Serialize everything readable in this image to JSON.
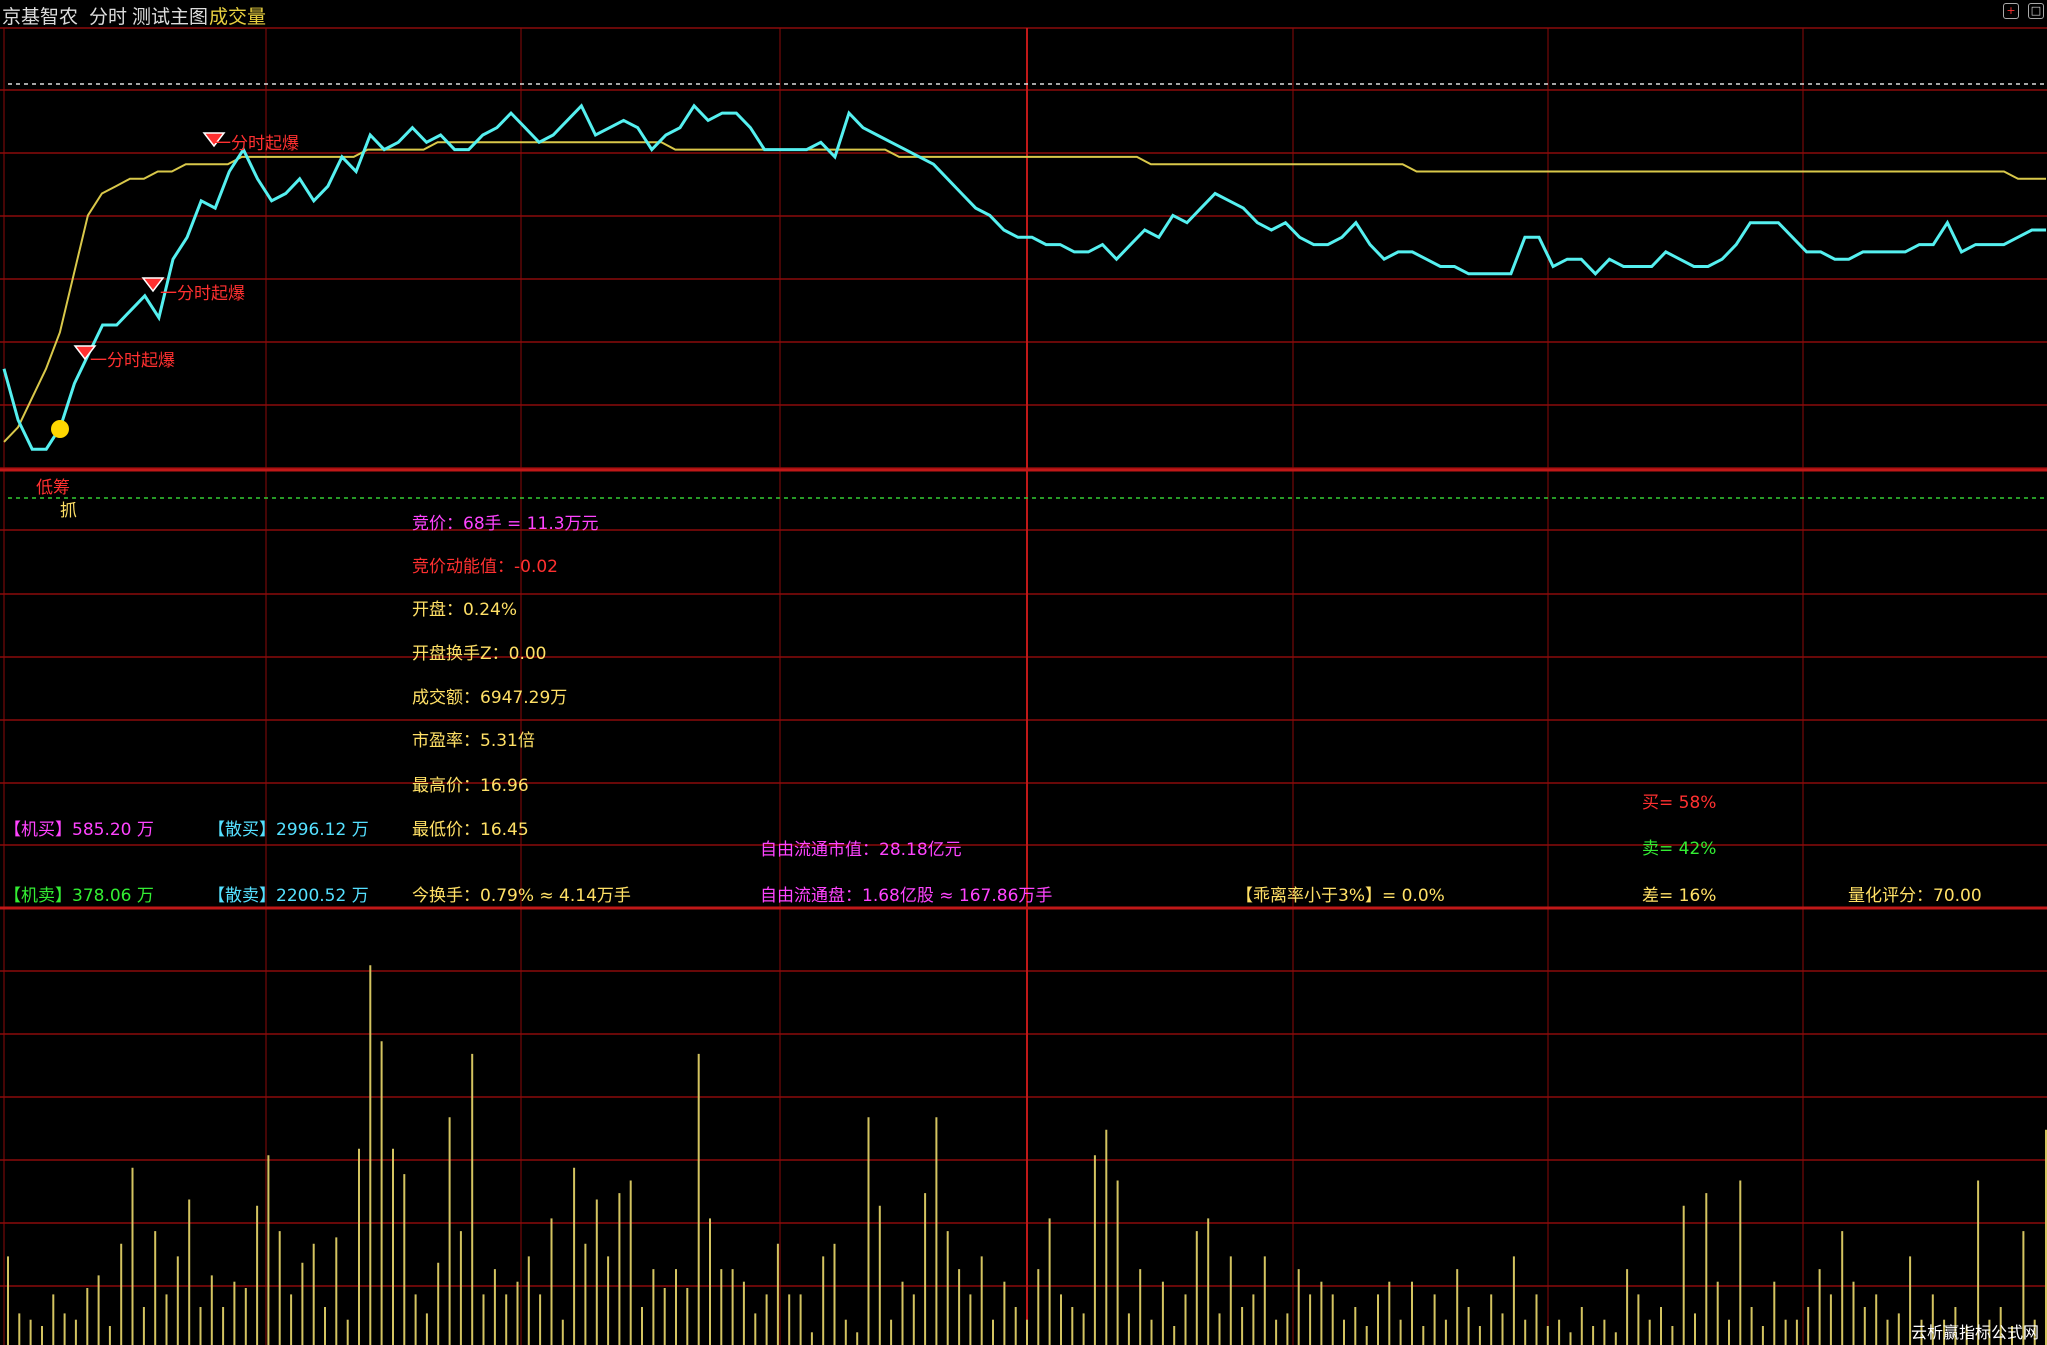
{
  "header": {
    "stock_name": "京基智农",
    "tab_intraday": "分时",
    "tab_main_chart": "测试主图",
    "tab_volume": "成交量"
  },
  "colors": {
    "background": "#000000",
    "grid": "#8b0a0a",
    "price_line": "#55f0f0",
    "avg_line": "#d9c84a",
    "volume_bar": "#d4c460",
    "magenta": "#ff44ff",
    "red": "#ff3030",
    "yellow": "#ffe066",
    "green": "#33ee33",
    "cyan": "#55e0ff"
  },
  "signals": {
    "signal_1": "一分时起爆",
    "signal_2": "一分时起爆",
    "signal_3": "一分时起爆",
    "dip_label": "低筹",
    "catch_label": "抓"
  },
  "stats": {
    "bid_price": "竞价：68手 = 11.3万元",
    "bid_momentum": "竞价动能值：-0.02",
    "open": "开盘：0.24%",
    "open_turnover": "开盘换手Z：0.00",
    "amount": "成交额：6947.29万",
    "pe": "市盈率：5.31倍",
    "high": "最高价：16.96",
    "low": "最低价：16.45",
    "turnover_today": "今换手：0.79% ≈ 4.14万手",
    "free_float_mv": "自由流通市值：28.18亿元",
    "free_float_shares": "自由流通盘：1.68亿股 ≈ 167.86万手",
    "deviation": "【乖离率小于3%】= 0.0%",
    "buy_pct": "买= 58%",
    "sell_pct": "卖= 42%",
    "diff_pct": "差= 16%",
    "quant_score": "量化评分：70.00",
    "inst_buy": "【机买】585.20 万",
    "retail_buy": "【散买】2996.12 万",
    "inst_sell": "【机卖】378.06 万",
    "retail_sell": "【散卖】2200.52 万"
  },
  "chart_data": {
    "type": "line",
    "series": [
      {
        "values": [
          16.6,
          16.53,
          16.49,
          16.49,
          16.52,
          16.58,
          16.62,
          16.66,
          16.66,
          16.68,
          16.7,
          16.67,
          16.75,
          16.78,
          16.83,
          16.82,
          16.87,
          16.9,
          16.86,
          16.83,
          16.84,
          16.86,
          16.83,
          16.85,
          16.89,
          16.87,
          16.92,
          16.9,
          16.91,
          16.93,
          16.91,
          16.92,
          16.9,
          16.9,
          16.92,
          16.93,
          16.95,
          16.93,
          16.91,
          16.92,
          16.94,
          16.96,
          16.92,
          16.93,
          16.94,
          16.93,
          16.9,
          16.92,
          16.93,
          16.96,
          16.94,
          16.95,
          16.95,
          16.93,
          16.9,
          16.9,
          16.9,
          16.9,
          16.91,
          16.89,
          16.95,
          16.93,
          16.92,
          16.91,
          16.9,
          16.89,
          16.88,
          16.86,
          16.84,
          16.82,
          16.81,
          16.79,
          16.78,
          16.78,
          16.77,
          16.77,
          16.76,
          16.76,
          16.77,
          16.75,
          16.77,
          16.79,
          16.78,
          16.81,
          16.8,
          16.82,
          16.84,
          16.83,
          16.82,
          16.8,
          16.79,
          16.8,
          16.78,
          16.77,
          16.77,
          16.78,
          16.8,
          16.77,
          16.75,
          16.76,
          16.76,
          16.75,
          16.74,
          16.74,
          16.73,
          16.73,
          16.73,
          16.73,
          16.78,
          16.78,
          16.74,
          16.75,
          16.75,
          16.73,
          16.75,
          16.74,
          16.74,
          16.74,
          16.76,
          16.75,
          16.74,
          16.74,
          16.75,
          16.77,
          16.8,
          16.8,
          16.8,
          16.78,
          16.76,
          16.76,
          16.75,
          16.75,
          16.76,
          16.76,
          16.76,
          16.76,
          16.77,
          16.77,
          16.8,
          16.76,
          16.77,
          16.77,
          16.77,
          16.78,
          16.79,
          16.79
        ]
      },
      {
        "values": [
          16.5,
          16.52,
          16.56,
          16.6,
          16.65,
          16.73,
          16.81,
          16.84,
          16.85,
          16.86,
          16.86,
          16.87,
          16.87,
          16.88,
          16.88,
          16.88,
          16.88,
          16.89,
          16.89,
          16.89,
          16.89,
          16.89,
          16.89,
          16.89,
          16.89,
          16.89,
          16.9,
          16.9,
          16.9,
          16.9,
          16.9,
          16.91,
          16.91,
          16.91,
          16.91,
          16.91,
          16.91,
          16.91,
          16.91,
          16.91,
          16.91,
          16.91,
          16.91,
          16.91,
          16.91,
          16.91,
          16.91,
          16.91,
          16.9,
          16.9,
          16.9,
          16.9,
          16.9,
          16.9,
          16.9,
          16.9,
          16.9,
          16.9,
          16.9,
          16.9,
          16.9,
          16.9,
          16.9,
          16.9,
          16.89,
          16.89,
          16.89,
          16.89,
          16.89,
          16.89,
          16.89,
          16.89,
          16.89,
          16.89,
          16.89,
          16.89,
          16.89,
          16.89,
          16.89,
          16.89,
          16.89,
          16.89,
          16.88,
          16.88,
          16.88,
          16.88,
          16.88,
          16.88,
          16.88,
          16.88,
          16.88,
          16.88,
          16.88,
          16.88,
          16.88,
          16.88,
          16.88,
          16.88,
          16.88,
          16.88,
          16.88,
          16.87,
          16.87,
          16.87,
          16.87,
          16.87,
          16.87,
          16.87,
          16.87,
          16.87,
          16.87,
          16.87,
          16.87,
          16.87,
          16.87,
          16.87,
          16.87,
          16.87,
          16.87,
          16.87,
          16.87,
          16.87,
          16.87,
          16.87,
          16.87,
          16.87,
          16.87,
          16.87,
          16.87,
          16.87,
          16.87,
          16.87,
          16.87,
          16.87,
          16.87,
          16.87,
          16.87,
          16.87,
          16.87,
          16.87,
          16.87,
          16.87,
          16.87,
          16.87,
          16.86,
          16.86,
          16.86
        ]
      }
    ],
    "ylim": [
      16.4,
      17.05
    ],
    "volume": {
      "values": [
        14,
        5,
        4,
        3,
        8,
        5,
        4,
        9,
        11,
        3,
        16,
        28,
        6,
        18,
        8,
        14,
        23,
        6,
        11,
        6,
        10,
        9,
        22,
        30,
        18,
        8,
        13,
        16,
        6,
        17,
        4,
        31,
        60,
        48,
        31,
        27,
        8,
        5,
        13,
        36,
        18,
        46,
        8,
        12,
        8,
        10,
        14,
        8,
        20,
        4,
        28,
        16,
        23,
        14,
        24,
        26,
        6,
        12,
        9,
        12,
        9,
        46,
        20,
        12,
        12,
        10,
        5,
        8,
        16,
        8,
        8,
        2,
        14,
        16,
        4,
        2,
        36,
        22,
        4,
        10,
        8,
        24,
        36,
        18,
        12,
        8,
        14,
        4,
        10,
        6,
        4,
        12,
        20,
        8,
        6,
        5,
        30,
        34,
        26,
        5,
        12,
        4,
        10,
        3,
        8,
        18,
        20,
        5,
        14,
        6,
        8,
        14,
        4,
        5,
        12,
        8,
        10,
        8,
        4,
        6,
        3,
        8,
        10,
        4,
        10,
        3,
        8,
        4,
        12,
        6,
        3,
        8,
        5,
        14,
        4,
        8,
        3,
        4,
        2,
        6,
        3,
        4,
        2,
        12,
        8,
        4,
        6,
        3,
        22,
        5,
        24,
        10,
        4,
        26,
        6,
        3,
        10,
        4,
        4,
        6,
        12,
        8,
        18,
        10,
        6,
        8,
        4,
        5,
        14,
        4,
        8,
        4,
        6,
        3,
        26,
        4,
        6,
        3,
        18,
        4,
        34
      ]
    }
  },
  "watermark": "云析赢指标公式网"
}
